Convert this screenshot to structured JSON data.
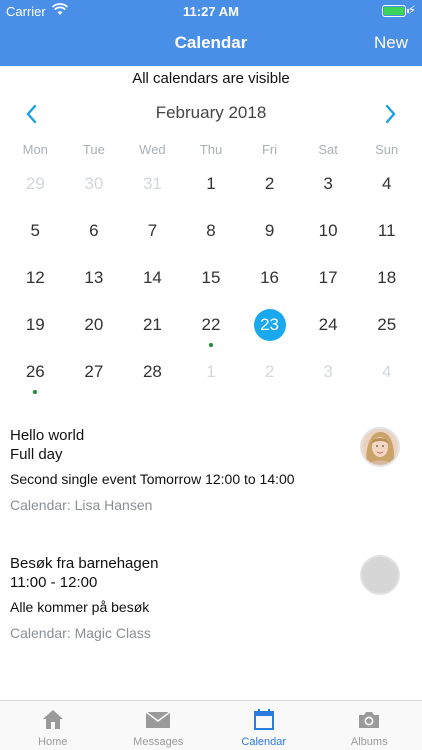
{
  "status_bar": {
    "carrier": "Carrier",
    "time": "11:27 AM"
  },
  "nav": {
    "title": "Calendar",
    "new_label": "New"
  },
  "visibility_note": "All calendars are visible",
  "month": {
    "label": "February 2018",
    "prev_icon": "chevron-left-icon",
    "next_icon": "chevron-right-icon"
  },
  "weekdays": [
    "Mon",
    "Tue",
    "Wed",
    "Thu",
    "Fri",
    "Sat",
    "Sun"
  ],
  "days": [
    {
      "n": "29",
      "muted": true
    },
    {
      "n": "30",
      "muted": true
    },
    {
      "n": "31",
      "muted": true
    },
    {
      "n": "1"
    },
    {
      "n": "2"
    },
    {
      "n": "3"
    },
    {
      "n": "4"
    },
    {
      "n": "5"
    },
    {
      "n": "6"
    },
    {
      "n": "7"
    },
    {
      "n": "8"
    },
    {
      "n": "9"
    },
    {
      "n": "10"
    },
    {
      "n": "11"
    },
    {
      "n": "12"
    },
    {
      "n": "13"
    },
    {
      "n": "14"
    },
    {
      "n": "15"
    },
    {
      "n": "16"
    },
    {
      "n": "17"
    },
    {
      "n": "18"
    },
    {
      "n": "19"
    },
    {
      "n": "20"
    },
    {
      "n": "21"
    },
    {
      "n": "22",
      "dot": true
    },
    {
      "n": "23",
      "selected": true
    },
    {
      "n": "24"
    },
    {
      "n": "25"
    },
    {
      "n": "26",
      "dot": true
    },
    {
      "n": "27"
    },
    {
      "n": "28"
    },
    {
      "n": "1",
      "muted": true
    },
    {
      "n": "2",
      "muted": true
    },
    {
      "n": "3",
      "muted": true
    },
    {
      "n": "4",
      "muted": true
    }
  ],
  "events": [
    {
      "title": "Hello world",
      "time": "Full day",
      "description": "Second single event Tomorrow 12:00 to 14:00",
      "calendar": "Calendar: Lisa Hansen",
      "avatar": "photo"
    },
    {
      "title": "Besøk fra barnehagen",
      "time": "11:00 - 12:00",
      "description": "Alle kommer på besøk",
      "calendar": "Calendar: Magic Class",
      "avatar": "placeholder"
    }
  ],
  "tabs": [
    {
      "label": "Home",
      "icon": "home-icon",
      "active": false
    },
    {
      "label": "Messages",
      "icon": "envelope-icon",
      "active": false
    },
    {
      "label": "Calendar",
      "icon": "calendar-icon",
      "active": true
    },
    {
      "label": "Albums",
      "icon": "camera-icon",
      "active": false
    }
  ],
  "colors": {
    "accent": "#4a8fe7",
    "selected_day": "#1aa9ee",
    "event_dot": "#1e8a3a",
    "tab_active": "#2e7be0"
  }
}
